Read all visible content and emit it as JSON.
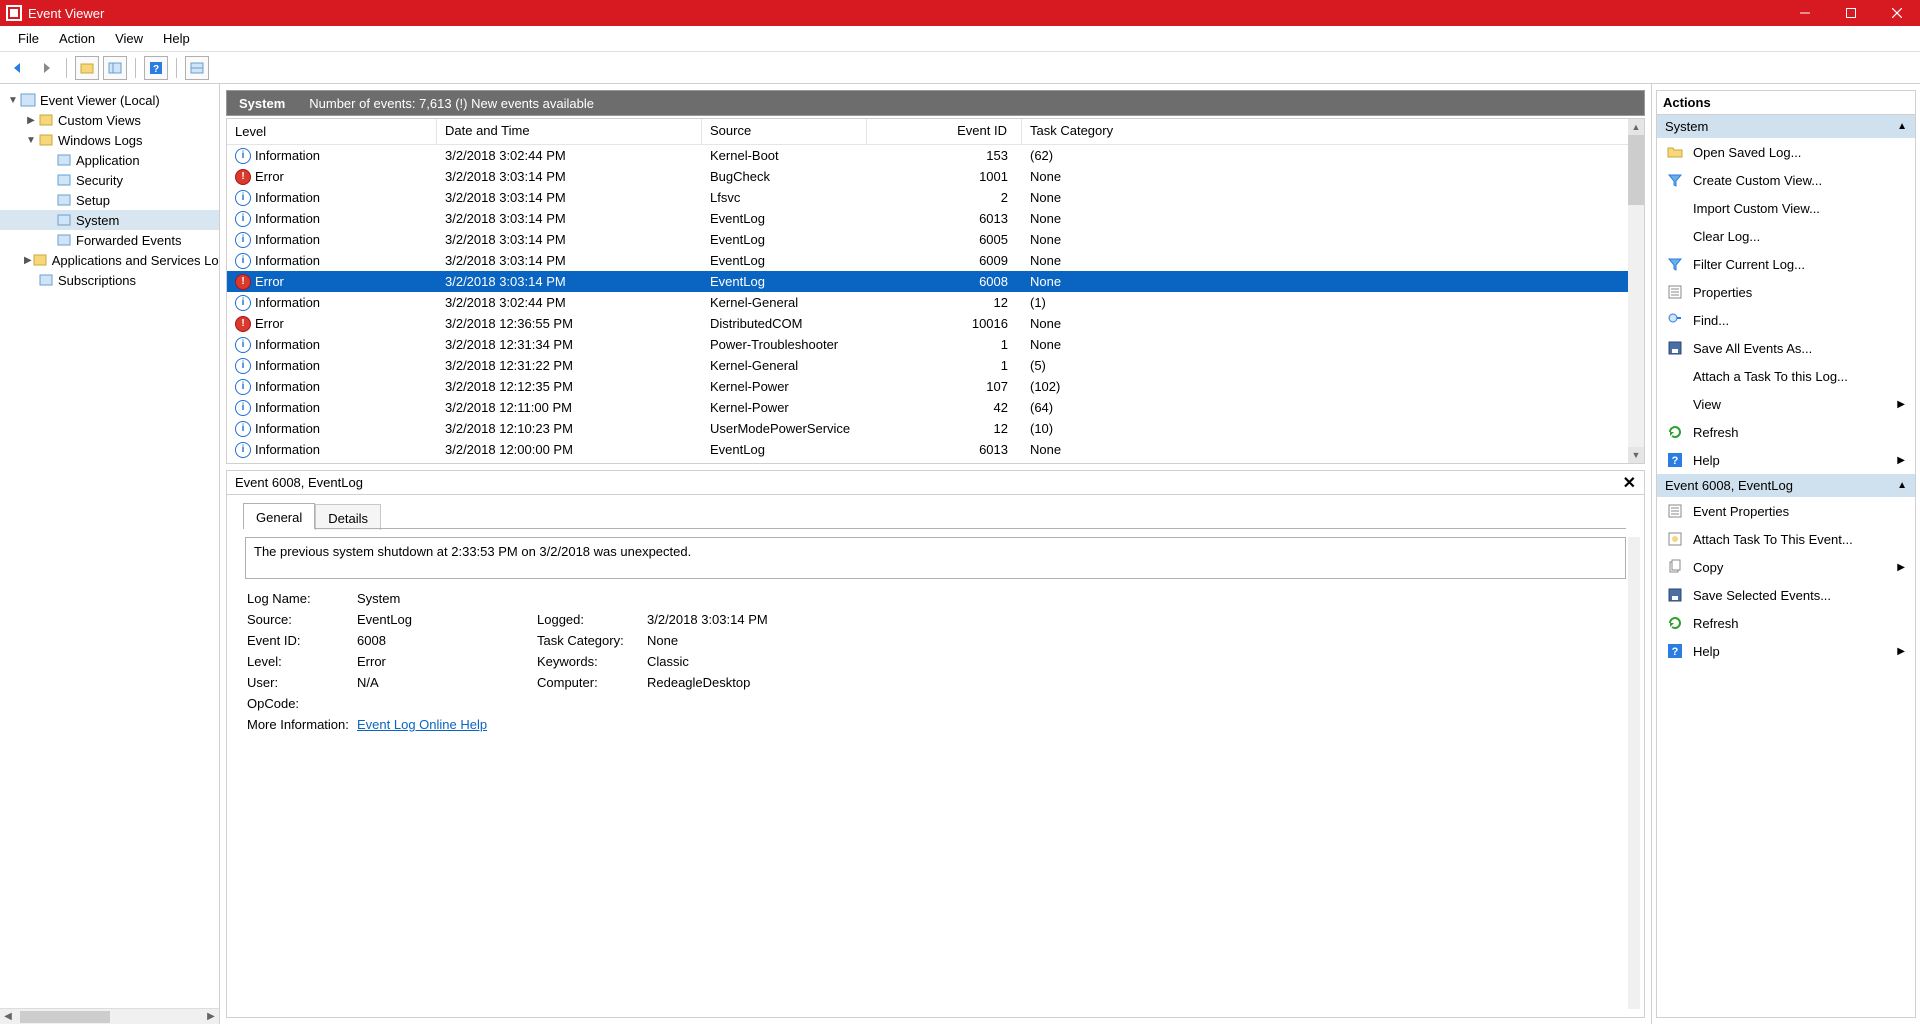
{
  "window": {
    "title": "Event Viewer"
  },
  "menu": [
    "File",
    "Action",
    "View",
    "Help"
  ],
  "tree": {
    "root": "Event Viewer (Local)",
    "items": [
      {
        "label": "Custom Views",
        "exp": "▶",
        "indent": 1,
        "icon": "folder"
      },
      {
        "label": "Windows Logs",
        "exp": "▼",
        "indent": 1,
        "icon": "folder"
      },
      {
        "label": "Application",
        "exp": "",
        "indent": 2,
        "icon": "log"
      },
      {
        "label": "Security",
        "exp": "",
        "indent": 2,
        "icon": "log"
      },
      {
        "label": "Setup",
        "exp": "",
        "indent": 2,
        "icon": "log"
      },
      {
        "label": "System",
        "exp": "",
        "indent": 2,
        "icon": "log",
        "selected": true
      },
      {
        "label": "Forwarded Events",
        "exp": "",
        "indent": 2,
        "icon": "log"
      },
      {
        "label": "Applications and Services Logs",
        "exp": "▶",
        "indent": 1,
        "icon": "folder"
      },
      {
        "label": "Subscriptions",
        "exp": "",
        "indent": 1,
        "icon": "sub"
      }
    ]
  },
  "listHeader": {
    "title": "System",
    "count_text": "Number of events: 7,613 (!) New events available"
  },
  "columns": [
    "Level",
    "Date and Time",
    "Source",
    "Event ID",
    "Task Category"
  ],
  "events": [
    {
      "level": "Information",
      "dt": "3/2/2018 3:02:44 PM",
      "src": "Kernel-Boot",
      "id": "153",
      "cat": "(62)"
    },
    {
      "level": "Error",
      "dt": "3/2/2018 3:03:14 PM",
      "src": "BugCheck",
      "id": "1001",
      "cat": "None"
    },
    {
      "level": "Information",
      "dt": "3/2/2018 3:03:14 PM",
      "src": "Lfsvc",
      "id": "2",
      "cat": "None"
    },
    {
      "level": "Information",
      "dt": "3/2/2018 3:03:14 PM",
      "src": "EventLog",
      "id": "6013",
      "cat": "None"
    },
    {
      "level": "Information",
      "dt": "3/2/2018 3:03:14 PM",
      "src": "EventLog",
      "id": "6005",
      "cat": "None"
    },
    {
      "level": "Information",
      "dt": "3/2/2018 3:03:14 PM",
      "src": "EventLog",
      "id": "6009",
      "cat": "None"
    },
    {
      "level": "Error",
      "dt": "3/2/2018 3:03:14 PM",
      "src": "EventLog",
      "id": "6008",
      "cat": "None",
      "selected": true
    },
    {
      "level": "Information",
      "dt": "3/2/2018 3:02:44 PM",
      "src": "Kernel-General",
      "id": "12",
      "cat": "(1)"
    },
    {
      "level": "Error",
      "dt": "3/2/2018 12:36:55 PM",
      "src": "DistributedCOM",
      "id": "10016",
      "cat": "None"
    },
    {
      "level": "Information",
      "dt": "3/2/2018 12:31:34 PM",
      "src": "Power-Troubleshooter",
      "id": "1",
      "cat": "None"
    },
    {
      "level": "Information",
      "dt": "3/2/2018 12:31:22 PM",
      "src": "Kernel-General",
      "id": "1",
      "cat": "(5)"
    },
    {
      "level": "Information",
      "dt": "3/2/2018 12:12:35 PM",
      "src": "Kernel-Power",
      "id": "107",
      "cat": "(102)"
    },
    {
      "level": "Information",
      "dt": "3/2/2018 12:11:00 PM",
      "src": "Kernel-Power",
      "id": "42",
      "cat": "(64)"
    },
    {
      "level": "Information",
      "dt": "3/2/2018 12:10:23 PM",
      "src": "UserModePowerService",
      "id": "12",
      "cat": "(10)"
    },
    {
      "level": "Information",
      "dt": "3/2/2018 12:00:00 PM",
      "src": "EventLog",
      "id": "6013",
      "cat": "None"
    }
  ],
  "detail": {
    "title": "Event 6008, EventLog",
    "tabs": {
      "general": "General",
      "details": "Details"
    },
    "description": "The previous system shutdown at 2:33:53 PM on 3/2/2018 was unexpected.",
    "labels": {
      "logname": "Log Name:",
      "source": "Source:",
      "eventid": "Event ID:",
      "level": "Level:",
      "user": "User:",
      "opcode": "OpCode:",
      "moreinfo": "More Information:",
      "logged": "Logged:",
      "taskcat": "Task Category:",
      "keywords": "Keywords:",
      "computer": "Computer:"
    },
    "values": {
      "logname": "System",
      "source": "EventLog",
      "eventid": "6008",
      "level": "Error",
      "user": "N/A",
      "opcode": "",
      "logged": "3/2/2018 3:03:14 PM",
      "taskcat": "None",
      "keywords": "Classic",
      "computer": "RedeagleDesktop",
      "moreinfo_link": "Event Log Online Help"
    }
  },
  "actions": {
    "title": "Actions",
    "section1": "System",
    "group1": [
      {
        "label": "Open Saved Log...",
        "icon": "open"
      },
      {
        "label": "Create Custom View...",
        "icon": "funnel"
      },
      {
        "label": "Import Custom View...",
        "icon": ""
      },
      {
        "label": "Clear Log...",
        "icon": ""
      },
      {
        "label": "Filter Current Log...",
        "icon": "funnel"
      },
      {
        "label": "Properties",
        "icon": "props"
      },
      {
        "label": "Find...",
        "icon": "find"
      },
      {
        "label": "Save All Events As...",
        "icon": "save"
      },
      {
        "label": "Attach a Task To this Log...",
        "icon": ""
      },
      {
        "label": "View",
        "icon": "",
        "submenu": true
      },
      {
        "label": "Refresh",
        "icon": "refresh"
      },
      {
        "label": "Help",
        "icon": "help",
        "submenu": true
      }
    ],
    "section2": "Event 6008, EventLog",
    "group2": [
      {
        "label": "Event Properties",
        "icon": "props"
      },
      {
        "label": "Attach Task To This Event...",
        "icon": "task"
      },
      {
        "label": "Copy",
        "icon": "copy",
        "submenu": true
      },
      {
        "label": "Save Selected Events...",
        "icon": "save"
      },
      {
        "label": "Refresh",
        "icon": "refresh"
      },
      {
        "label": "Help",
        "icon": "help",
        "submenu": true
      }
    ]
  }
}
